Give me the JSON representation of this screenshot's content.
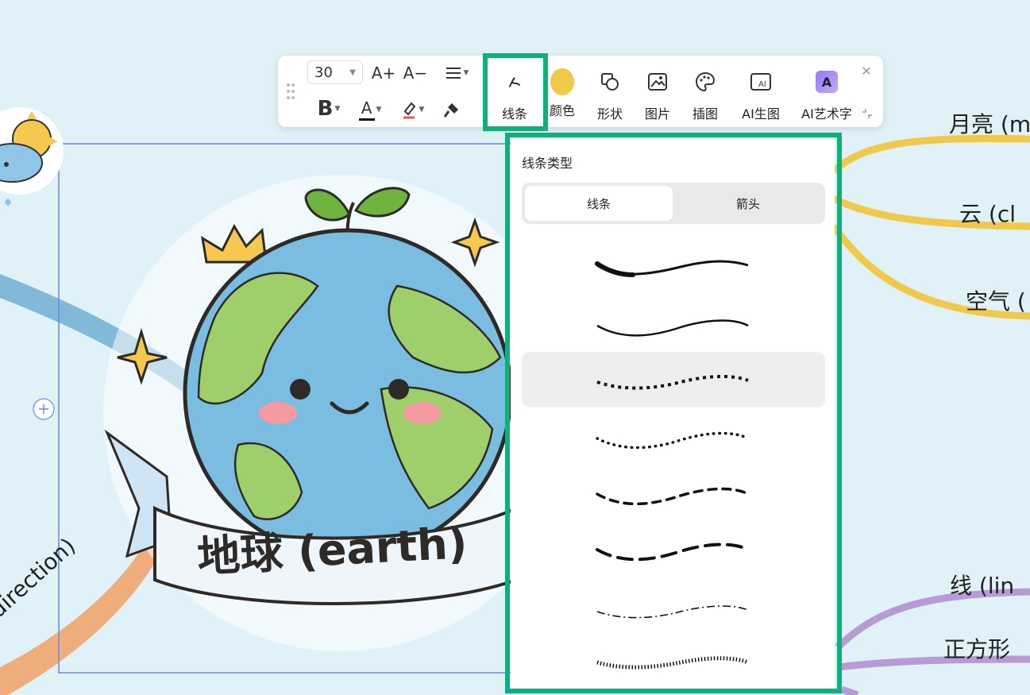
{
  "canvas": {
    "central_topic": "地球 (earth)",
    "branch_labels": [
      "月亮 (m",
      "云 (cl",
      "空气 (",
      "线 (lin",
      "正方形",
      "direction)"
    ],
    "expand_button": "+"
  },
  "toolbar": {
    "font_size": "30",
    "font_increase": "A+",
    "font_decrease": "A−",
    "bold": "B",
    "text_color_letter": "A",
    "tools": [
      {
        "label": "线条",
        "icon": "line-style-icon"
      },
      {
        "label": "颜色",
        "icon": "color-swatch-icon"
      },
      {
        "label": "形状",
        "icon": "shape-icon"
      },
      {
        "label": "图片",
        "icon": "image-icon"
      },
      {
        "label": "插图",
        "icon": "palette-icon"
      },
      {
        "label": "AI生图",
        "icon": "ai-image-icon"
      },
      {
        "label": "AI艺术字",
        "icon": "ai-art-text-icon"
      }
    ],
    "close": "✕",
    "colors": {
      "swatch": "#f0c84a",
      "highlight": "#10b07a"
    }
  },
  "line_panel": {
    "title": "线条类型",
    "tabs": [
      "线条",
      "箭头"
    ],
    "active_tab": "线条",
    "styles": [
      "tapered",
      "solid",
      "arrows",
      "dotted",
      "dashed",
      "long-dash",
      "dash-dot",
      "chevron"
    ],
    "selected_style": "arrows"
  }
}
